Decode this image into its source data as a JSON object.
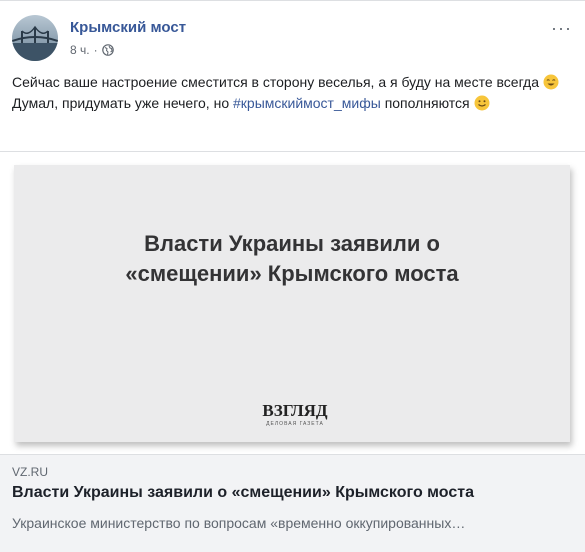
{
  "post": {
    "page_name": "Крымский мост",
    "time": "8 ч.",
    "dot": "·",
    "more": "···",
    "text_part1": "Сейчас ваше настроение сместится в сторону веселья, а я буду на месте всегда",
    "text_part2": "Думал, придумать уже нечего, но",
    "hashtag": "#крымскиймост_мифы",
    "text_part3": "пополняются"
  },
  "link_card": {
    "image_headline_line1": "Власти Украины заявили о",
    "image_headline_line2": "«смещении» Крымского моста",
    "image_logo": "ВЗГЛЯД",
    "image_logo_sub": "ДЕЛОВАЯ ГАЗЕТА",
    "domain": "VZ.RU",
    "title": "Власти Украины заявили о «смещении» Крымского моста",
    "description": "Украинское министерство по вопросам «временно оккупированных…"
  },
  "icons": {
    "globe": "globe-icon",
    "more": "more-options-icon",
    "emoji1": "grinning-squint-emoji",
    "emoji2": "smiling-emoji"
  },
  "colors": {
    "link_blue": "#385898",
    "emoji_yellow": "#f7c53a"
  }
}
